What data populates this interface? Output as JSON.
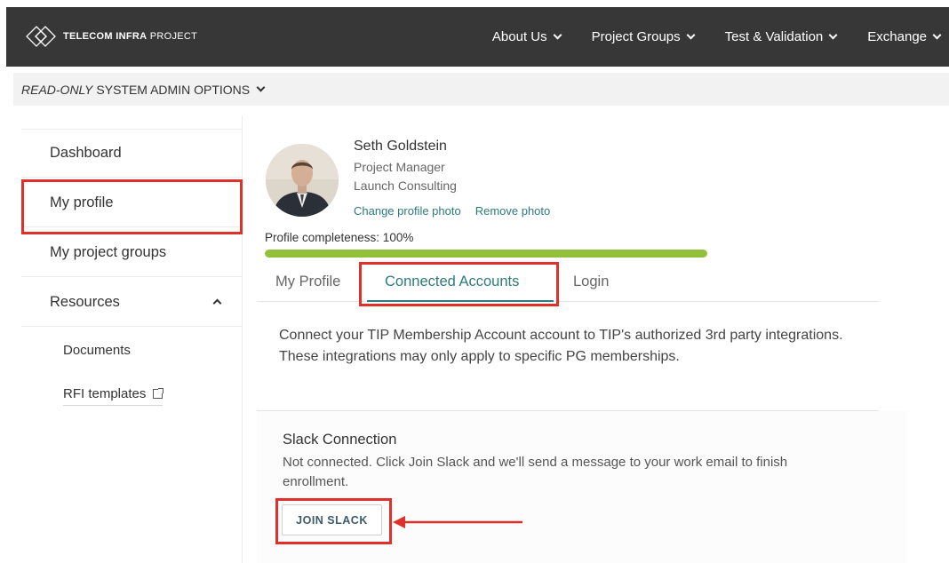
{
  "header": {
    "logo_bold": "TELECOM INFRA",
    "logo_light": "PROJECT",
    "nav": [
      {
        "label": "About Us"
      },
      {
        "label": "Project Groups"
      },
      {
        "label": "Test & Validation"
      },
      {
        "label": "Exchange"
      }
    ]
  },
  "admin_bar": {
    "italic": "READ-ONLY",
    "label": "SYSTEM ADMIN OPTIONS"
  },
  "sidebar": {
    "items": [
      {
        "label": "Dashboard"
      },
      {
        "label": "My profile"
      },
      {
        "label": "My project groups"
      },
      {
        "label": "Resources"
      }
    ],
    "subitems": [
      {
        "label": "Documents"
      },
      {
        "label": "RFI templates"
      }
    ]
  },
  "profile": {
    "name": "Seth Goldstein",
    "role": "Project Manager",
    "company": "Launch Consulting",
    "change_photo": "Change profile photo",
    "remove_photo": "Remove photo",
    "completeness_label": "Profile completeness: 100%",
    "completeness_fraction": 1.0
  },
  "tabs": [
    {
      "label": "My Profile"
    },
    {
      "label": "Connected Accounts"
    },
    {
      "label": "Login"
    }
  ],
  "connected": {
    "intro": "Connect your TIP Membership Account account to TIP's authorized 3rd party integrations. These integrations may only apply to specific PG memberships.",
    "slack_title": "Slack Connection",
    "slack_desc": "Not connected. Click Join Slack and we'll send a message to your work email to finish enrollment.",
    "join_button": "JOIN SLACK"
  },
  "colors": {
    "topbar": "#373737",
    "accent": "#2c7a7b",
    "progress": "#93c03a",
    "highlight": "#e0302a"
  }
}
